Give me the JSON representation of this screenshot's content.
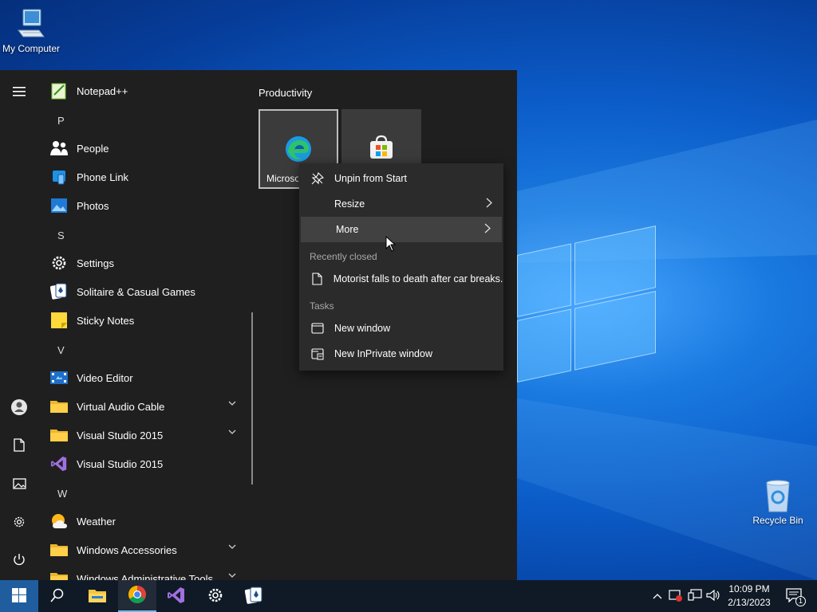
{
  "desktop": {
    "icons": [
      {
        "label": "My Computer",
        "icon": "computer-icon"
      },
      {
        "label": "Recycle Bin",
        "icon": "recycle-bin-icon"
      }
    ]
  },
  "start_menu": {
    "rail": [
      {
        "icon": "hamburger-menu-icon"
      },
      {
        "icon": "user-account-icon"
      },
      {
        "icon": "documents-icon"
      },
      {
        "icon": "pictures-icon"
      },
      {
        "icon": "settings-gear-icon"
      },
      {
        "icon": "power-icon"
      }
    ],
    "app_list": [
      {
        "type": "app",
        "label": "Notepad++",
        "icon": "notepadpp-icon"
      },
      {
        "type": "letter",
        "label": "P"
      },
      {
        "type": "app",
        "label": "People",
        "icon": "people-icon"
      },
      {
        "type": "app",
        "label": "Phone Link",
        "icon": "phone-link-icon"
      },
      {
        "type": "app",
        "label": "Photos",
        "icon": "photos-icon"
      },
      {
        "type": "letter",
        "label": "S"
      },
      {
        "type": "app",
        "label": "Settings",
        "icon": "settings-icon"
      },
      {
        "type": "app",
        "label": "Solitaire & Casual Games",
        "icon": "solitaire-icon"
      },
      {
        "type": "app",
        "label": "Sticky Notes",
        "icon": "sticky-notes-icon"
      },
      {
        "type": "letter",
        "label": "V"
      },
      {
        "type": "app",
        "label": "Video Editor",
        "icon": "video-editor-icon"
      },
      {
        "type": "folder",
        "label": "Virtual Audio Cable",
        "icon": "folder-icon",
        "expandable": true
      },
      {
        "type": "folder",
        "label": "Visual Studio 2015",
        "icon": "folder-icon",
        "expandable": true
      },
      {
        "type": "app",
        "label": "Visual Studio 2015",
        "icon": "visual-studio-icon"
      },
      {
        "type": "letter",
        "label": "W"
      },
      {
        "type": "app",
        "label": "Weather",
        "icon": "weather-icon"
      },
      {
        "type": "folder",
        "label": "Windows Accessories",
        "icon": "folder-icon",
        "expandable": true
      },
      {
        "type": "folder",
        "label": "Windows Administrative Tools",
        "icon": "folder-icon",
        "expandable": true
      }
    ],
    "group_title": "Productivity",
    "tiles": [
      {
        "label": "Microso",
        "icon": "edge-icon"
      },
      {
        "label": "",
        "icon": "microsoft-store-icon"
      }
    ]
  },
  "context_menu": {
    "items": [
      {
        "label": "Unpin from Start",
        "icon": "unpin-icon",
        "submenu": false
      },
      {
        "label": "Resize",
        "icon": "",
        "submenu": true
      },
      {
        "label": "More",
        "icon": "",
        "submenu": true,
        "hovered": true
      }
    ],
    "recent_header": "Recently closed",
    "recent_items": [
      {
        "label": "Motorist falls to death after car breaks...",
        "icon": "document-icon"
      }
    ],
    "tasks_header": "Tasks",
    "tasks": [
      {
        "label": "New window",
        "icon": "window-icon"
      },
      {
        "label": "New InPrivate window",
        "icon": "inprivate-window-icon"
      }
    ]
  },
  "taskbar": {
    "pinned": [
      {
        "icon": "windows-start-icon"
      },
      {
        "icon": "search-icon"
      },
      {
        "icon": "file-explorer-icon"
      },
      {
        "icon": "chrome-icon",
        "active": true
      },
      {
        "icon": "visual-studio-icon"
      },
      {
        "icon": "settings-gear-icon"
      },
      {
        "icon": "solitaire-icon"
      }
    ],
    "tray": [
      {
        "icon": "chevron-up-icon"
      },
      {
        "icon": "security-alert-icon"
      },
      {
        "icon": "network-icon"
      },
      {
        "icon": "volume-icon"
      }
    ],
    "clock": {
      "time": "10:09 PM",
      "date": "2/13/2023"
    },
    "notifications": {
      "icon": "action-center-icon",
      "count": "1"
    }
  },
  "colors": {
    "start_bg": "#1f1f1f",
    "menu_bg": "#2b2b2b",
    "taskbar_bg": "#101a26",
    "accent": "#0078d7"
  }
}
